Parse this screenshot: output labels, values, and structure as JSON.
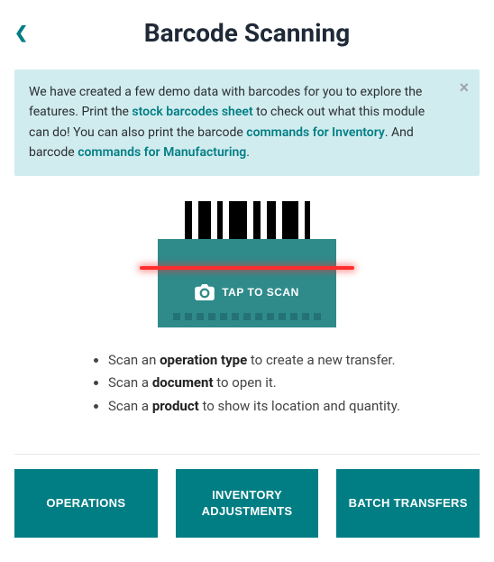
{
  "header": {
    "title": "Barcode Scanning"
  },
  "banner": {
    "text1": "We have created a few demo data with barcodes for you to explore the features. Print the ",
    "link1": "stock barcodes sheet",
    "text2": " to check out what this module can do! You can also print the barcode ",
    "link2": "commands for Inventory",
    "text3": ". And barcode ",
    "link3": "commands for Manufacturing",
    "text4": "."
  },
  "scan": {
    "label": "TAP TO SCAN"
  },
  "instructions": {
    "items": [
      {
        "pre": "Scan an ",
        "bold": "operation type",
        "post": " to create a new transfer."
      },
      {
        "pre": "Scan a ",
        "bold": "document",
        "post": " to open it."
      },
      {
        "pre": "Scan a ",
        "bold": "product",
        "post": " to show its location and quantity."
      }
    ]
  },
  "buttons": {
    "operations": "OPERATIONS",
    "inventory": "INVENTORY ADJUSTMENTS",
    "batch": "BATCH TRANSFERS"
  }
}
